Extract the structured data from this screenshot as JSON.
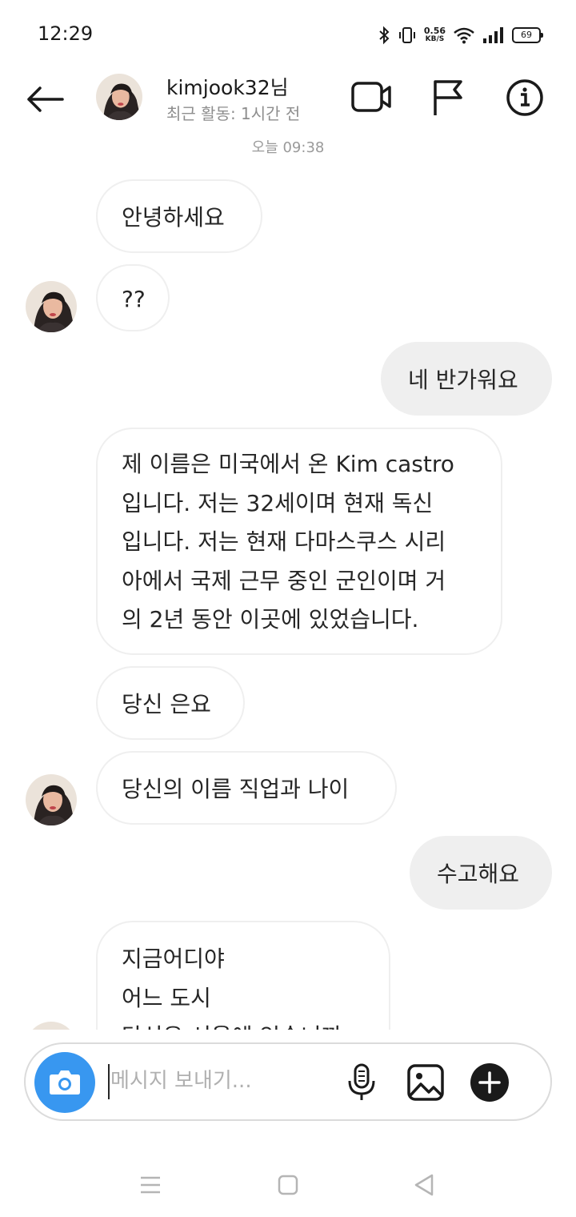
{
  "status_bar": {
    "time": "12:29",
    "net_speed_value": "0.56",
    "net_speed_unit": "KB/S",
    "battery": "69"
  },
  "header": {
    "username": "kimjook32님",
    "activity": "최근 활동: 1시간 전",
    "icons": [
      "back-arrow-icon",
      "video-camera-icon",
      "flag-icon",
      "info-icon"
    ]
  },
  "thread": {
    "timestamp": "오늘 09:38",
    "messages": [
      {
        "direction": "in",
        "text": "안녕하세요"
      },
      {
        "direction": "in",
        "text": "??"
      },
      {
        "direction": "out",
        "text": "네 반가워요"
      },
      {
        "direction": "in",
        "lines": [
          "제 이름은 미국에서 온 Kim castro",
          "입니다. 저는 32세이며 현재 독신",
          "입니다. 저는 현재 다마스쿠스 시리",
          "아에서 국제 근무 중인 군인이며 거",
          "의 2년 동안 이곳에 있었습니다."
        ]
      },
      {
        "direction": "in",
        "text": "당신 은요"
      },
      {
        "direction": "in",
        "text": "당신의 이름 직업과 나이"
      },
      {
        "direction": "out",
        "text": "수고해요"
      },
      {
        "direction": "in",
        "lines": [
          "지금어디야",
          "어느 도시",
          "당신은 서울에 있습니까"
        ]
      }
    ]
  },
  "composer": {
    "placeholder": "메시지 보내기...",
    "icons": [
      "camera-icon",
      "microphone-icon",
      "gallery-icon",
      "plus-icon"
    ]
  },
  "colors": {
    "camera_button": "#3897f0",
    "outgoing_bubble": "#efefef",
    "incoming_border": "#efefef",
    "secondary_text": "#8e8e8e"
  },
  "nav_bar": {
    "icons": [
      "menu-icon",
      "home-icon",
      "back-icon"
    ]
  }
}
